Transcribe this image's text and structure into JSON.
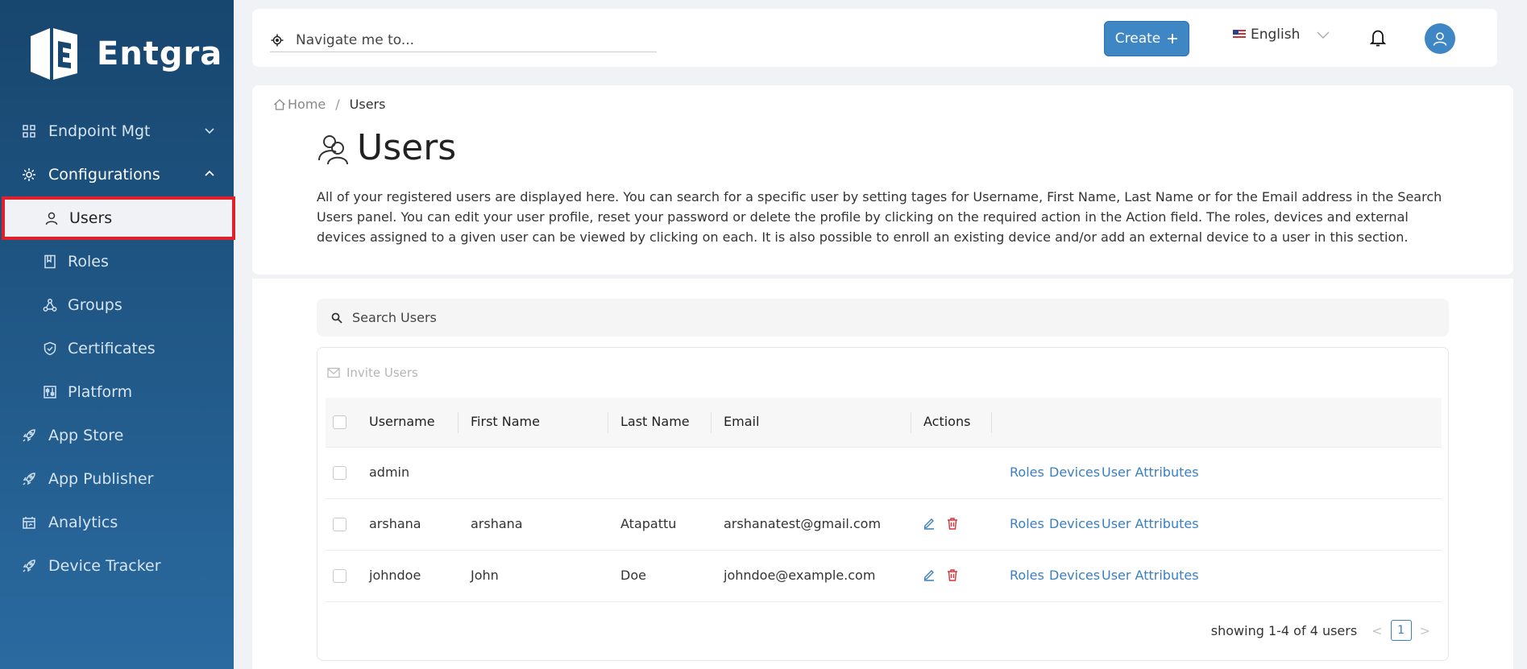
{
  "brand": {
    "name": "Entgra"
  },
  "sidebar": {
    "items": [
      {
        "label": "Endpoint Mgt",
        "icon": "grid-icon",
        "expanded": false
      },
      {
        "label": "Configurations",
        "icon": "gear-icon",
        "expanded": true
      },
      {
        "label": "App Store",
        "icon": "rocket-icon"
      },
      {
        "label": "App Publisher",
        "icon": "rocket-icon"
      },
      {
        "label": "Analytics",
        "icon": "analytics-icon"
      },
      {
        "label": "Device Tracker",
        "icon": "rocket-icon"
      }
    ],
    "subitems": [
      {
        "label": "Users",
        "icon": "user-icon",
        "active": true
      },
      {
        "label": "Roles",
        "icon": "book-icon"
      },
      {
        "label": "Groups",
        "icon": "cluster-icon"
      },
      {
        "label": "Certificates",
        "icon": "shield-icon"
      },
      {
        "label": "Platform",
        "icon": "sliders-icon"
      }
    ]
  },
  "header": {
    "navigate_placeholder": "Navigate me to...",
    "create_label": "Create",
    "language": "English",
    "accent": "#3e86c4"
  },
  "breadcrumb": {
    "home": "Home",
    "sep": "/",
    "current": "Users"
  },
  "page": {
    "title": "Users",
    "description": "All of your registered users are displayed here. You can search for a specific user by setting tages for Username, First Name, Last Name or for the Email address in the Search Users panel. You can edit your user profile, reset your password or delete the profile by clicking on the required action in the Action field. The roles, devices and external devices assigned to a given user can be viewed by clicking on each. It is also possible to enroll an existing device and/or add an external device to a user in this section."
  },
  "search": {
    "placeholder": "Search Users"
  },
  "table": {
    "invite_label": "Invite Users",
    "columns": [
      "Username",
      "First Name",
      "Last Name",
      "Email",
      "Actions"
    ],
    "rows": [
      {
        "username": "admin",
        "first": "",
        "last": "",
        "email": "",
        "editable": false
      },
      {
        "username": "arshana",
        "first": "arshana",
        "last": "Atapattu",
        "email": "arshanatest@gmail.com",
        "editable": true
      },
      {
        "username": "johndoe",
        "first": "John",
        "last": "Doe",
        "email": "johndoe@example.com",
        "editable": true
      }
    ],
    "links": {
      "roles": "Roles",
      "devices": "Devices",
      "attributes": "User Attributes"
    }
  },
  "pagination": {
    "summary": "showing 1-4 of 4 users",
    "prev": "<",
    "page": "1",
    "next": ">"
  }
}
